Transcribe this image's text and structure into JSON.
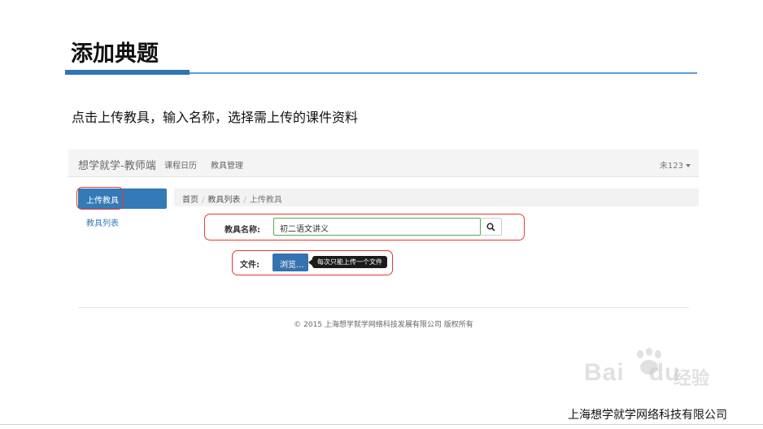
{
  "slide": {
    "title": "添加典题",
    "instruction": "点击上传教具，输入名称，选择需上传的课件资料",
    "company": "上海想学就学网络科技有限公司"
  },
  "app": {
    "brand": "想学就学-教师端",
    "nav": [
      "课程日历",
      "教具管理"
    ],
    "user": "未123"
  },
  "sidebar": {
    "active_item": "上传教具",
    "item": "教具列表"
  },
  "breadcrumb": [
    "首页",
    "教具列表",
    "上传教具"
  ],
  "form": {
    "name_label": "教具名称:",
    "name_value": "初二语文讲义",
    "file_label": "文件:",
    "browse_label": "浏览...",
    "tooltip": "每次只能上传一个文件"
  },
  "footer": "© 2015 上海想学就学网络科技发展有限公司 版权所有",
  "watermark": {
    "text": "Bai",
    "suffix": "du",
    "cn": "经验"
  },
  "colors": {
    "accent": "#337ab7",
    "highlight": "#e53935",
    "title_rule": "#2e75b6"
  }
}
